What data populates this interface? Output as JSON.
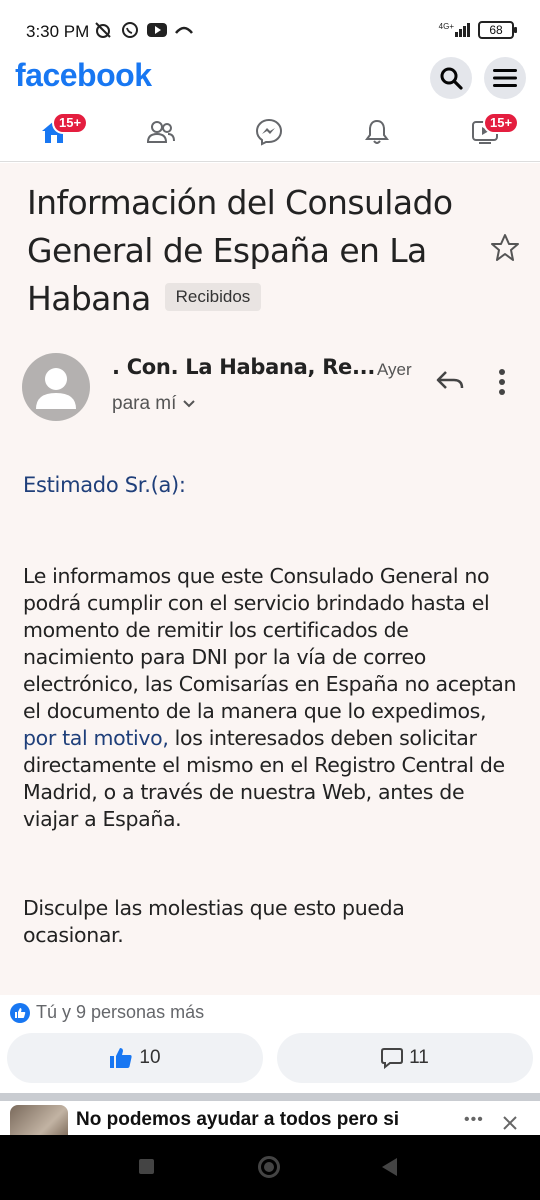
{
  "status_bar": {
    "time": "3:30 PM",
    "network": "4G+",
    "battery": "68"
  },
  "header": {
    "logo": "facebook",
    "search_icon": "search-icon",
    "menu_icon": "hamburger-menu-icon"
  },
  "nav": {
    "home_badge": "15+",
    "watch_badge": "15+",
    "colors": {
      "brand": "#1877f2",
      "badge": "#e41e3f"
    }
  },
  "email": {
    "title": "Información del Consulado General de España en La Habana",
    "label_chip": "Recibidos",
    "sender": ". Con. La Habana, Re...",
    "date": "Ayer",
    "recipient": "para mí",
    "greeting": "Estimado Sr.(a):",
    "body_part1": "Le informamos que este Consulado General no podrá cumplir con el servicio brindado hasta el momento de remitir los certificados de nacimiento para DNI por la vía de correo electrónico, las Comisarías en España no aceptan el documento de la manera que lo expedimos,",
    "body_link": " por tal motivo,",
    "body_part2": " los interesados deben solicitar directamente el mismo en el Registro Central de Madrid, o a través de nuestra Web, antes de viajar a España.",
    "closing": "Disculpe las molestias que esto pueda ocasionar."
  },
  "reactions": {
    "summary": "Tú y 9 personas más",
    "likes": "10",
    "comments": "11"
  },
  "next_post": {
    "title": "No podemos ayudar a todos pero si",
    "dots": "•••"
  }
}
